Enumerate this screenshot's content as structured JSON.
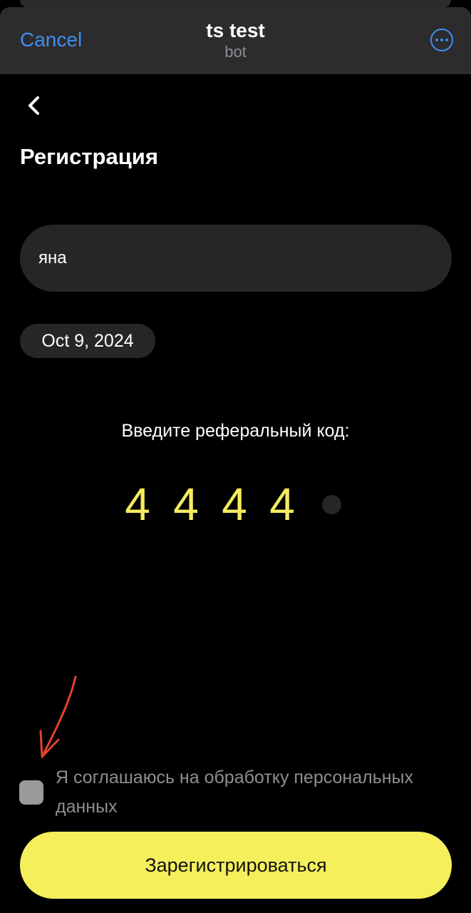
{
  "header": {
    "cancel_label": "Cancel",
    "title": "ts test",
    "subtitle": "bot",
    "more_icon": "more-circle-icon"
  },
  "page": {
    "back_icon": "chevron-left-icon",
    "title": "Регистрация"
  },
  "form": {
    "name_value": "яна",
    "date_value": "Oct 9, 2024",
    "referral_label": "Введите реферальный код:",
    "referral_digits": [
      "4",
      "4",
      "4",
      "4"
    ],
    "referral_total_slots": 5,
    "consent_label": "Я соглашаюсь на обработку персональных данных",
    "consent_checked": false,
    "submit_label": "Зарегистрироваться"
  },
  "annotation": {
    "icon": "red-arrow-icon",
    "color": "#e0442a"
  },
  "colors": {
    "accent_blue": "#3f8ef0",
    "accent_yellow": "#f5ef5c",
    "field_bg": "#262628",
    "header_bg": "#2c2c2e",
    "background": "#000000"
  }
}
